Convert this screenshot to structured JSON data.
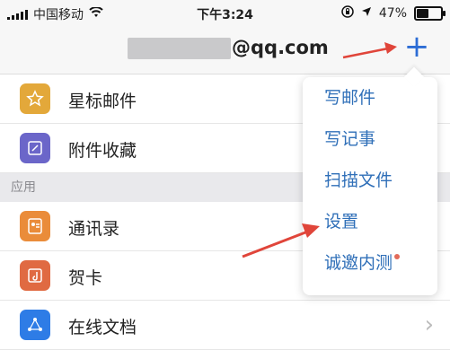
{
  "status": {
    "carrier": "中国移动",
    "time": "下午3:24",
    "battery": "47%",
    "battery_level": 0.47
  },
  "header": {
    "email": "@qq.com",
    "plus_icon": "plus-icon"
  },
  "list": {
    "items": [
      {
        "label": "星标邮件",
        "icon": "star-icon",
        "color": "#E3A83A"
      },
      {
        "label": "附件收藏",
        "icon": "attachment-icon",
        "color": "#6B66C9"
      }
    ],
    "section_title": "应用",
    "apps": [
      {
        "label": "通讯录",
        "icon": "contacts-icon",
        "color": "#EA8C3A"
      },
      {
        "label": "贺卡",
        "icon": "card-icon",
        "color": "#E06A42"
      },
      {
        "label": "在线文档",
        "icon": "docs-icon",
        "color": "#2E7CE6"
      }
    ]
  },
  "menu": {
    "items": [
      "写邮件",
      "写记事",
      "扫描文件",
      "设置",
      "诚邀内测"
    ],
    "badge_color": "#E36B5A"
  },
  "colors": {
    "accent": "#2D6DD5",
    "menu_text": "#2F6FB8",
    "annotation_arrow": "#E0453A"
  }
}
